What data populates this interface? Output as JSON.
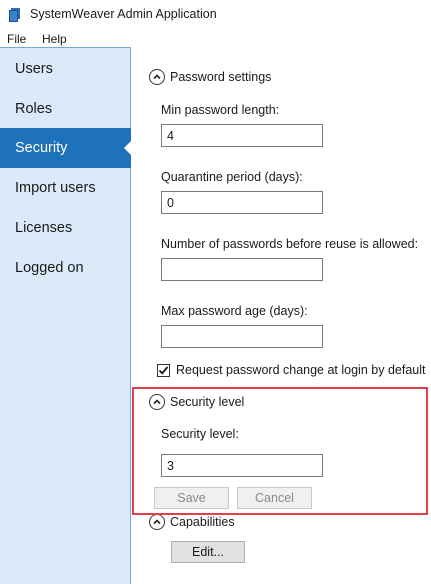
{
  "window": {
    "title": "SystemWeaver Admin Application",
    "icon": "app-book-icon"
  },
  "menu": {
    "items": [
      "File",
      "Help"
    ]
  },
  "sidebar": {
    "items": [
      {
        "label": "Users",
        "active": false
      },
      {
        "label": "Roles",
        "active": false
      },
      {
        "label": "Security",
        "active": true
      },
      {
        "label": "Import users",
        "active": false
      },
      {
        "label": "Licenses",
        "active": false
      },
      {
        "label": "Logged on",
        "active": false
      }
    ],
    "active_color": "#1e72b9",
    "background_color": "#daeaf9"
  },
  "password_settings": {
    "header": "Password settings",
    "min_length_label": "Min password length:",
    "min_length_value": "4",
    "quarantine_label": "Quarantine period (days):",
    "quarantine_value": "0",
    "reuse_label": "Number of passwords before reuse is allowed:",
    "reuse_value": "",
    "max_age_label": "Max password age (days):",
    "max_age_value": "",
    "request_change_label": "Request password change at login by default",
    "request_change_checked": true
  },
  "security_level": {
    "header": "Security level",
    "label": "Security level:",
    "value": "3",
    "save_label": "Save",
    "cancel_label": "Cancel"
  },
  "capabilities": {
    "header": "Capabilities",
    "edit_label": "Edit..."
  },
  "highlight_color": "#e0404a"
}
